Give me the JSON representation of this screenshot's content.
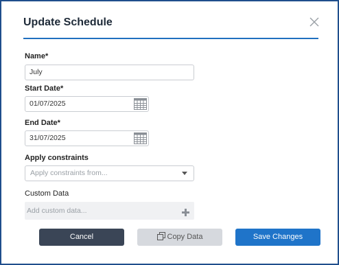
{
  "dialog": {
    "title": "Update Schedule",
    "close_icon": "close-icon"
  },
  "form": {
    "name": {
      "label": "Name*",
      "value": "July"
    },
    "start_date": {
      "label": "Start Date*",
      "value": "01/07/2025",
      "icon": "calendar-icon"
    },
    "end_date": {
      "label": "End Date*",
      "value": "31/07/2025",
      "icon": "calendar-icon"
    },
    "constraints": {
      "label": "Apply constraints",
      "placeholder": "Apply constraints from...",
      "icon": "chevron-down-icon"
    },
    "custom_data": {
      "label": "Custom Data",
      "placeholder": "Add custom data...",
      "icon": "plus-icon"
    }
  },
  "buttons": {
    "cancel": "Cancel",
    "copy": "Copy Data",
    "save": "Save Changes"
  },
  "colors": {
    "border": "#1f4e8c",
    "accent": "#1f74c9",
    "cancel_bg": "#3a4556",
    "copy_bg": "#d6d9de"
  }
}
